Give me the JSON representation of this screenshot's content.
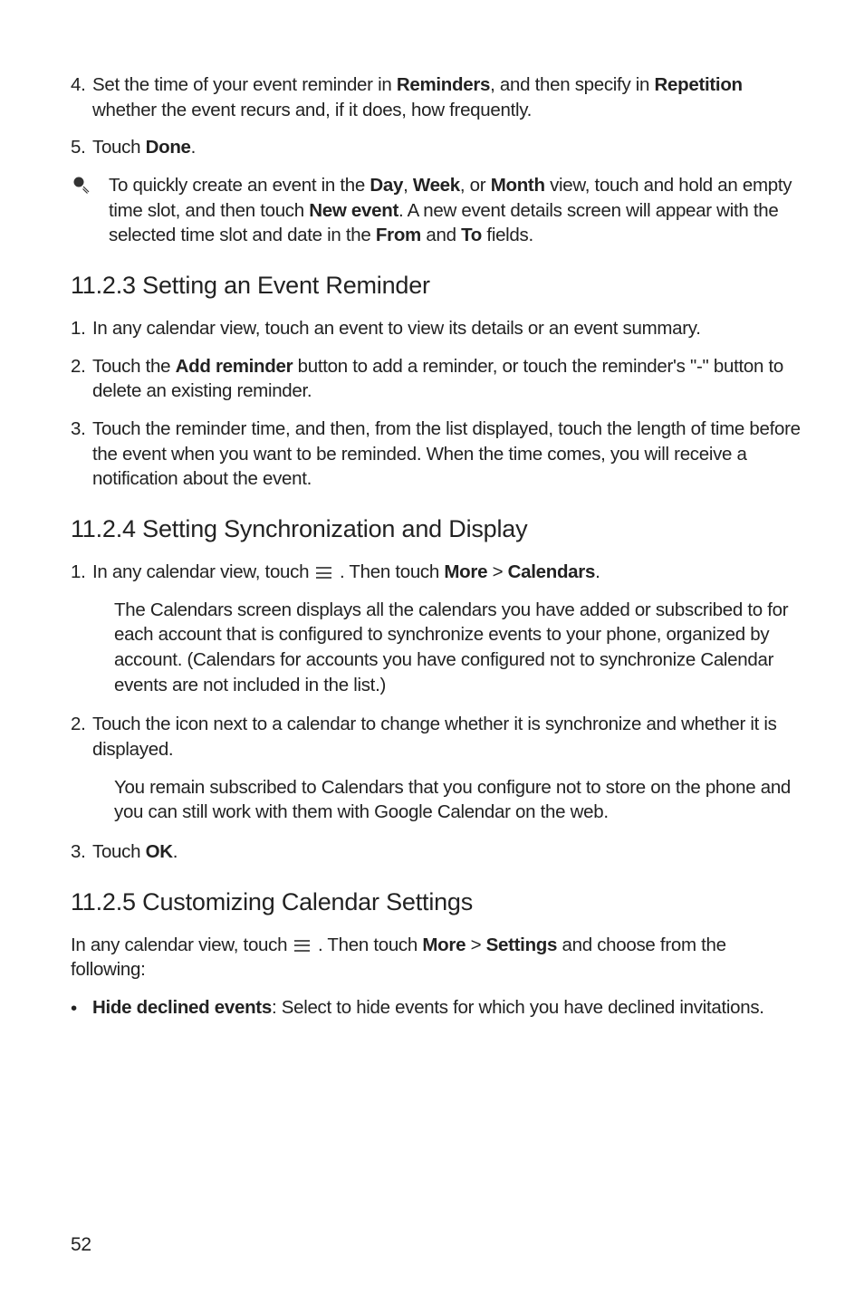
{
  "items": {
    "li4_num": "4.",
    "li4_a": "Set the time of your event reminder in ",
    "li4_b": "Reminders",
    "li4_c": ", and then specify in ",
    "li4_d": "Repetition",
    "li4_e": " whether the event recurs and, if it does, how frequently.",
    "li5_num": "5.",
    "li5_a": "Touch ",
    "li5_b": "Done",
    "li5_c": ".",
    "tip_a": "To quickly create an event in the ",
    "tip_b": "Day",
    "tip_c": ", ",
    "tip_d": "Week",
    "tip_e": ", or ",
    "tip_f": "Month",
    "tip_g": " view, touch and hold an empty time slot, and then touch ",
    "tip_h": "New event",
    "tip_i": ". A new event details screen will appear with the selected time slot and date in the ",
    "tip_j": "From",
    "tip_k": " and ",
    "tip_l": "To",
    "tip_m": " fields."
  },
  "h_1123": "11.2.3  Setting an Event Reminder",
  "s1123": {
    "li1_num": "1.",
    "li1": "In any calendar view, touch an event to view its details or an event summary.",
    "li2_num": "2.",
    "li2_a": "Touch the ",
    "li2_b": "Add reminder",
    "li2_c": " button to add a reminder, or touch the reminder's \"-\" button to delete an existing reminder.",
    "li3_num": "3.",
    "li3": "Touch the reminder time, and then, from the list displayed, touch the length of time before the event when you want to be reminded. When the time comes, you will receive a notification about the event."
  },
  "h_1124": "11.2.4  Setting Synchronization and Display",
  "s1124": {
    "li1_num": "1.",
    "li1_a": "In any calendar view, touch ",
    "li1_b": " . Then touch ",
    "li1_c": "More",
    "li1_d": " > ",
    "li1_e": "Calendars",
    "li1_f": ".",
    "li1_sub": "The Calendars screen displays all the calendars you have added or subscribed to for each account that is configured to synchronize events to your phone, organized by account. (Calendars for accounts you have configured not to synchronize Calendar events are not included in the list.)",
    "li2_num": "2.",
    "li2": "Touch the icon next to a calendar to change whether it is synchronize and whether it is displayed.",
    "li2_sub": "You remain subscribed to Calendars that you configure not to store on the phone and you can still work with them with Google Calendar on the web.",
    "li3_num": "3.",
    "li3_a": "Touch ",
    "li3_b": "OK",
    "li3_c": "."
  },
  "h_1125": "11.2.5  Customizing Calendar Settings",
  "s1125": {
    "intro_a": "In any calendar view, touch ",
    "intro_b": " . Then touch ",
    "intro_c": "More",
    "intro_d": " > ",
    "intro_e": "Settings",
    "intro_f": " and choose from the following:",
    "bullet_dot": "•",
    "bullet_a": "Hide declined events",
    "bullet_b": ": Select to hide events for which you have declined invitations."
  },
  "page_number": "52"
}
